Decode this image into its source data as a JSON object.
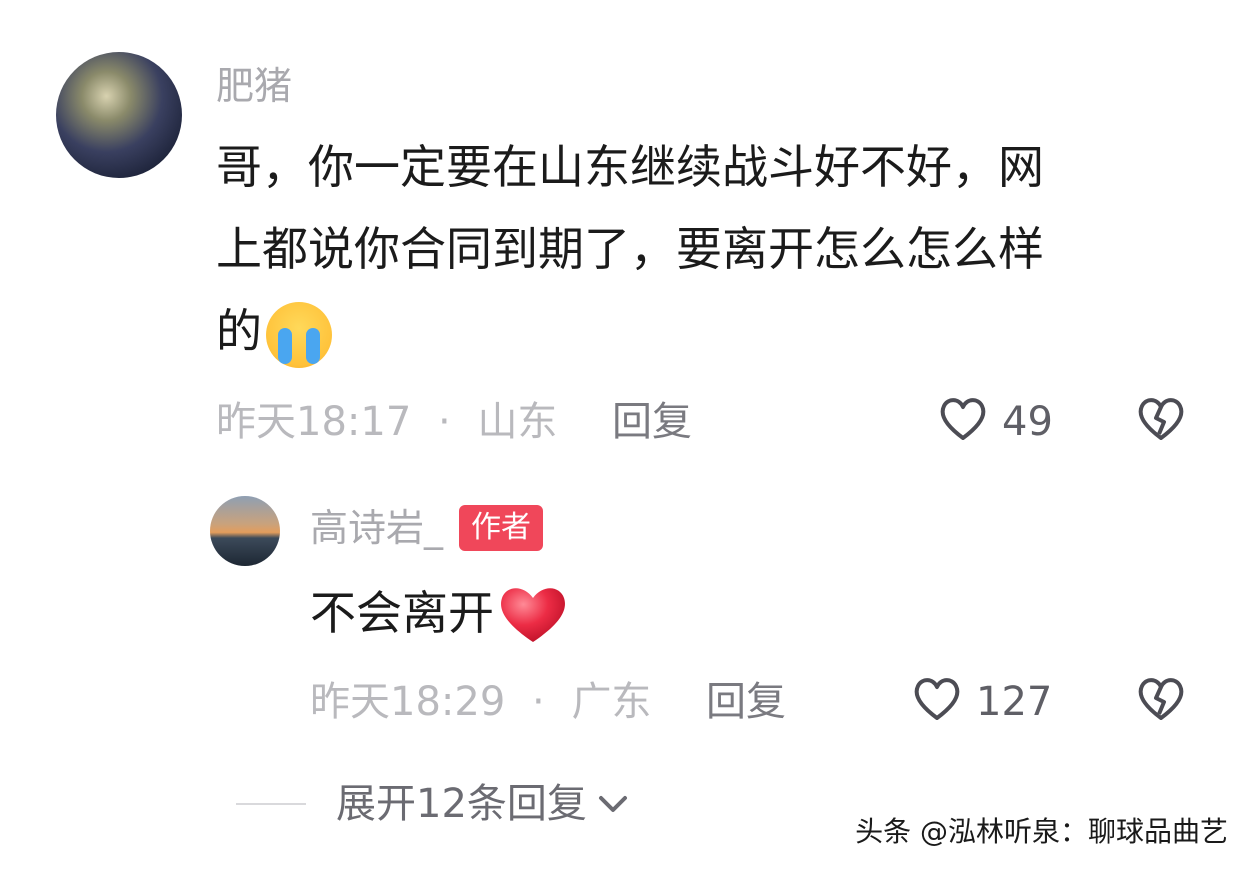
{
  "comment": {
    "username": "肥猪",
    "line1": "哥，你一定要在山东继续战斗好不好，网",
    "line2": "上都说你合同到期了，要离开怎么怎么样",
    "line3": "的",
    "emoji": "loudly-crying-face",
    "time": "昨天18:17",
    "separator": "·",
    "location": "山东",
    "reply_label": "回复",
    "likes": "49"
  },
  "reply": {
    "username": "高诗岩_",
    "badge": "作者",
    "text": "不会离开",
    "emoji": "red-heart",
    "time": "昨天18:29",
    "separator": "·",
    "location": "广东",
    "reply_label": "回复",
    "likes": "127"
  },
  "expand": {
    "label": "展开12条回复"
  },
  "watermark": "头条 @泓林听泉：聊球品曲艺",
  "colors": {
    "badge_bg": "#f0475a",
    "heart_emoji": "#e8283f",
    "cry_emoji": "#ffc23a"
  }
}
